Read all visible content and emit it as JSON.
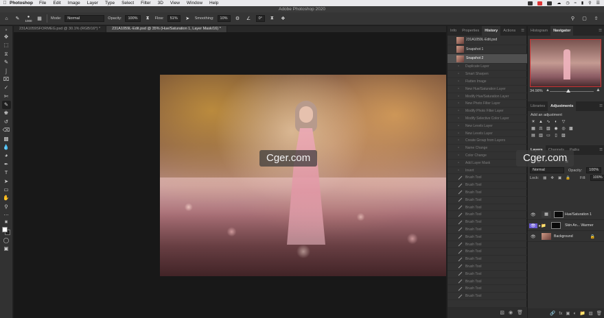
{
  "menubar": {
    "app_name": "Photoshop",
    "items": [
      "File",
      "Edit",
      "Image",
      "Layer",
      "Type",
      "Select",
      "Filter",
      "3D",
      "View",
      "Window",
      "Help"
    ]
  },
  "title_bar": {
    "title": "Adobe Photoshop 2020"
  },
  "options_bar": {
    "brush_size": "1000",
    "mode_label": "Mode:",
    "mode_value": "Normal",
    "opacity_label": "Opacity:",
    "opacity_value": "100%",
    "flow_label": "Flow:",
    "flow_value": "51%",
    "smoothing_label": "Smoothing:",
    "smoothing_value": "10%",
    "angle_value": "0°"
  },
  "document_tabs": [
    {
      "label": "231A1059SFORMEG.psd @ 30.1% (RGB/16*) *",
      "active": false
    },
    {
      "label": "231A1059L-Edit.psd @ 35% (Hue/Saturation 1, Layer Mask/16) *",
      "active": true
    }
  ],
  "mid_panel": {
    "tabs": [
      "Info",
      "Properties",
      "History",
      "Actions"
    ],
    "active_tab": "History",
    "history": {
      "snapshots": [
        "231A1059L-Edit.psd",
        "Snapshot 1",
        "Snapshot 2"
      ],
      "selected": "Snapshot 2",
      "states": [
        "Duplicate Layer",
        "Smart Sharpen",
        "Flatten Image",
        "New Hue/Saturation Layer",
        "Modify Hue/Saturation Layer",
        "New Photo Filter Layer",
        "Modify Photo Filter Layer",
        "Modify Selective Color Layer",
        "New Levels Layer",
        "New Levels Layer",
        "Create Group from Layers",
        "Name Change",
        "Color Change",
        "Add Layer Mask",
        "Invert",
        "Brush Tool",
        "Brush Tool",
        "Brush Tool",
        "Brush Tool",
        "Brush Tool",
        "Brush Tool",
        "Brush Tool",
        "Brush Tool",
        "Brush Tool",
        "Brush Tool",
        "Brush Tool",
        "Brush Tool",
        "Brush Tool",
        "Brush Tool",
        "Brush Tool",
        "Brush Tool",
        "Brush Tool"
      ]
    }
  },
  "right_panel": {
    "top_tabs": [
      "Histogram",
      "Navigator"
    ],
    "top_active": "Navigator",
    "navigator_zoom": "34.98%",
    "adj_tabs": [
      "Libraries",
      "Adjustments"
    ],
    "adj_active": "Adjustments",
    "adj_add_label": "Add an adjustment",
    "layer_tabs": [
      "Layers",
      "Channels",
      "Paths"
    ],
    "layer_active": "Layers",
    "blend_mode": "Normal",
    "opacity_label": "Opacity:",
    "opacity_value": "100%",
    "lock_label": "Lock:",
    "fill_label": "Fill:",
    "fill_value": "100%",
    "layers": [
      {
        "name": "Hue/Saturation 1",
        "selected": false
      },
      {
        "name": "Skin An... Warmer",
        "selected": false
      },
      {
        "name": "Background",
        "selected": false
      }
    ]
  },
  "watermarks": [
    "Cger.com",
    "Cger.com"
  ],
  "colors": {
    "ui_dark": "#323232",
    "canvas_bg": "#181818",
    "selection": "#505050",
    "accent_purple": "#6b5bd6"
  }
}
